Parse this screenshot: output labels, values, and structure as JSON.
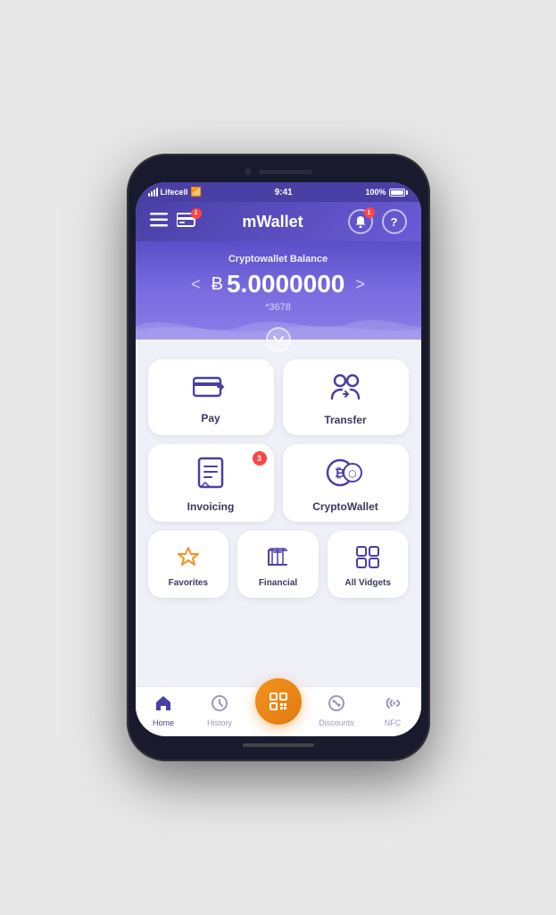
{
  "phone": {
    "status": {
      "carrier": "Lifecell",
      "time": "9:41",
      "battery": "100%"
    }
  },
  "header": {
    "title": "mWallet",
    "menu_label": "Menu",
    "card_label": "Card",
    "notifications_label": "Notifications",
    "help_label": "Help"
  },
  "balance": {
    "label": "Cryptowallet Balance",
    "symbol": "B",
    "amount": "5.0000000",
    "account": "*3678",
    "prev_label": "<",
    "next_label": ">"
  },
  "actions": {
    "pay": {
      "label": "Pay"
    },
    "transfer": {
      "label": "Transfer"
    },
    "invoicing": {
      "label": "Invoicing",
      "badge": "3"
    },
    "cryptowallet": {
      "label": "CryptoWallet"
    }
  },
  "widgets": {
    "favorites": {
      "label": "Favorites"
    },
    "financial": {
      "label": "Financial"
    },
    "all_vidgets": {
      "label": "All Vidgets"
    }
  },
  "nav": {
    "home": {
      "label": "Home"
    },
    "history": {
      "label": "History"
    },
    "scan": {
      "label": ""
    },
    "discounts": {
      "label": "Discounts"
    },
    "nfc": {
      "label": "NFC"
    }
  },
  "colors": {
    "primary": "#4a3fa5",
    "accent_orange": "#f5921e",
    "gradient_start": "#4a3fa5",
    "gradient_end": "#8b7de8"
  }
}
